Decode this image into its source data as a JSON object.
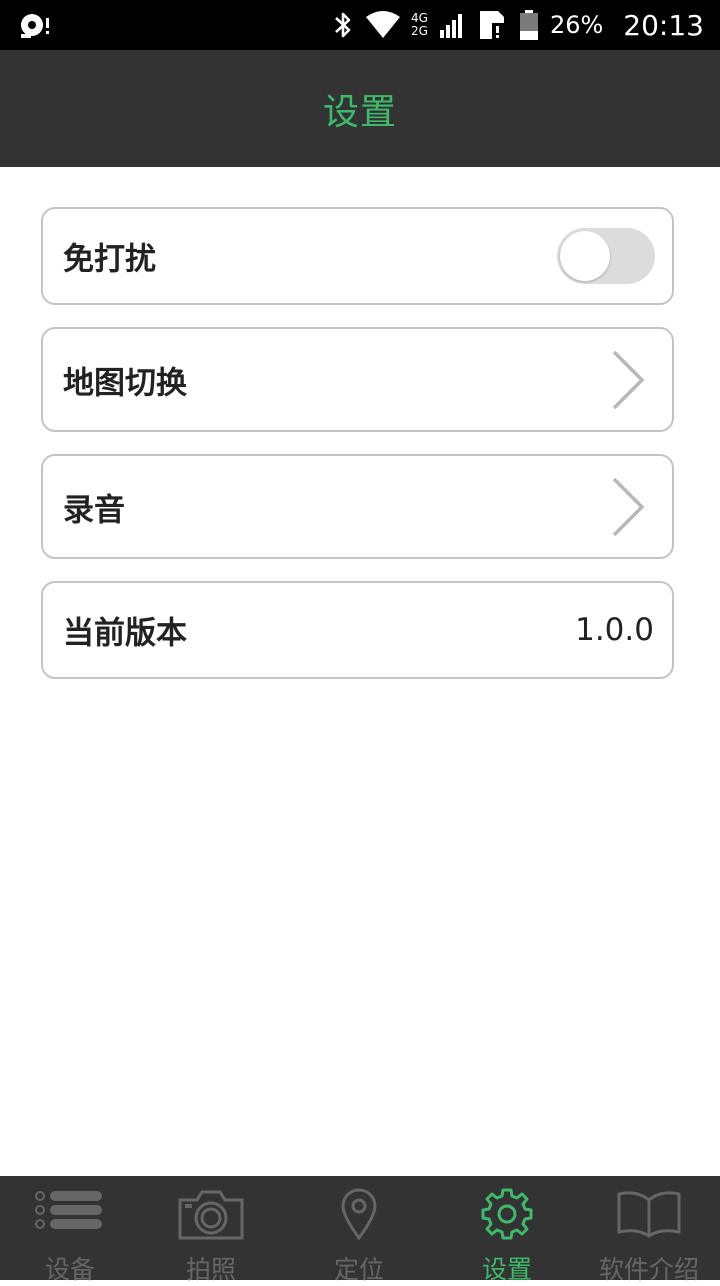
{
  "status_bar": {
    "network_top": "4G",
    "network_bottom": "2G",
    "battery_percent": "26%",
    "time": "20:13"
  },
  "header": {
    "title": "设置"
  },
  "settings": {
    "dnd": {
      "label": "免打扰",
      "toggle_on": false
    },
    "map_switch": {
      "label": "地图切换"
    },
    "recording": {
      "label": "录音"
    },
    "version": {
      "label": "当前版本",
      "value": "1.0.0"
    }
  },
  "nav": {
    "items": [
      {
        "label": "设备",
        "icon": "list-icon",
        "active": false
      },
      {
        "label": "拍照",
        "icon": "camera-icon",
        "active": false
      },
      {
        "label": "定位",
        "icon": "location-pin-icon",
        "active": false
      },
      {
        "label": "设置",
        "icon": "gear-icon",
        "active": true
      },
      {
        "label": "软件介绍",
        "icon": "book-icon",
        "active": false
      }
    ]
  },
  "colors": {
    "accent": "#3dbb6a",
    "header_bg": "#333333",
    "nav_inactive": "#666666",
    "card_border": "#c4c4c4",
    "toggle_off": "#dcdcdc"
  }
}
